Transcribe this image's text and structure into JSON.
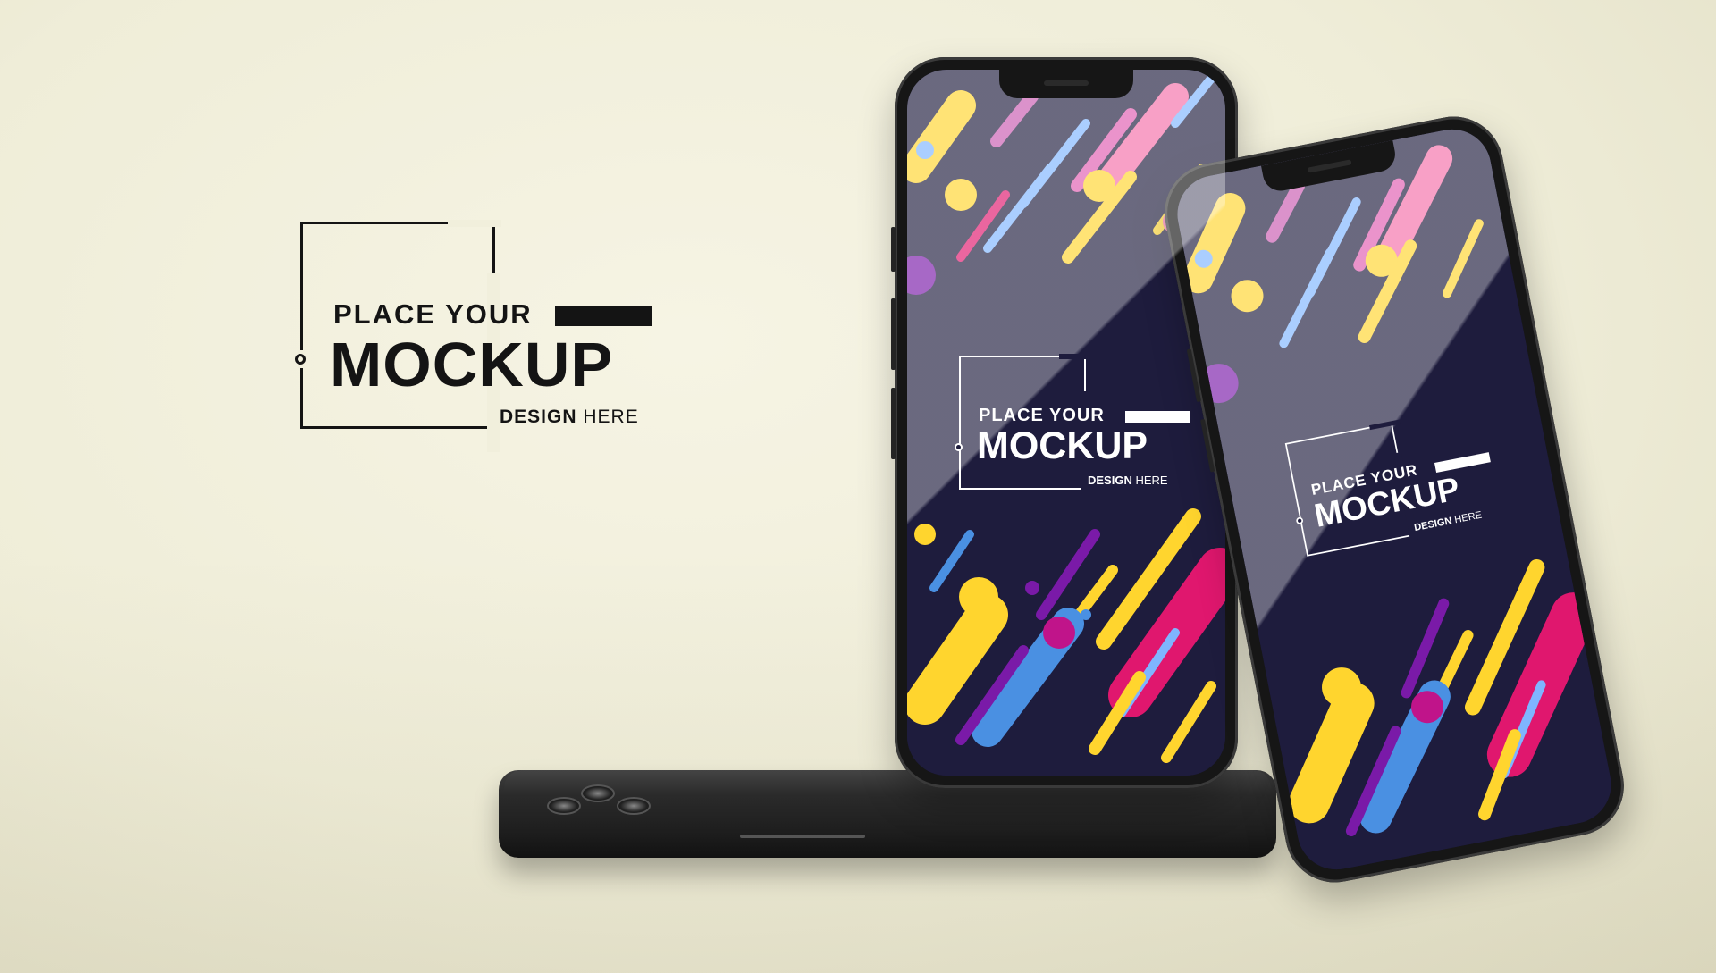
{
  "logo": {
    "line1": "PLACE YOUR",
    "line2": "MOCKUP",
    "line3_bold": "DESIGN",
    "line3_light": "HERE"
  },
  "screen_logo": {
    "line1": "PLACE YOUR",
    "line2": "MOCKUP",
    "line3_bold": "DESIGN",
    "line3_light": "HERE"
  },
  "colors": {
    "background": "#f1efdc",
    "logo_ink": "#141414",
    "phone_body": "#161616",
    "screen_bg": "#1e1c3d",
    "accent_yellow": "#ffd52e",
    "accent_magenta": "#e0176e",
    "accent_purple": "#7a1aa8",
    "accent_blue": "#4a90e2",
    "accent_pink": "#f56fa8"
  }
}
